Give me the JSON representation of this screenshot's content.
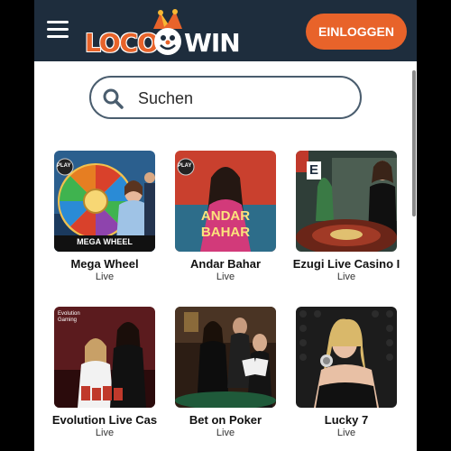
{
  "header": {
    "logo_left": "LOCO",
    "logo_right": "WIN",
    "login_label": "EINLOGGEN"
  },
  "search": {
    "placeholder": "Suchen"
  },
  "games": [
    {
      "title": "Mega Wheel",
      "status": "Live",
      "badge": "PLAY",
      "tile_caption": "MEGA WHEEL"
    },
    {
      "title": "Andar Bahar",
      "status": "Live",
      "badge": "PLAY",
      "tile_caption_1": "ANDAR",
      "tile_caption_2": "BAHAR"
    },
    {
      "title": "Ezugi Live Casino I",
      "status": "Live",
      "badge": "E"
    },
    {
      "title": "Evolution Live Cas",
      "status": "Live",
      "badge": "Evolution Gaming"
    },
    {
      "title": "Bet on Poker",
      "status": "Live"
    },
    {
      "title": "Lucky 7",
      "status": "Live"
    }
  ],
  "colors": {
    "header": "#1e2d3d",
    "accent": "#e8632a",
    "search_border": "#4a5d6e"
  }
}
